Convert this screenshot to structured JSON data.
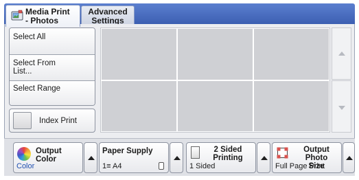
{
  "tabs": [
    {
      "line1": "Media Print",
      "line2": "- Photos",
      "active": true,
      "icon": "media-print-photo-icon"
    },
    {
      "line1": "Advanced",
      "line2": "Settings",
      "active": false
    }
  ],
  "selection": {
    "select_all": "Select All",
    "select_from_list_1": "Select From",
    "select_from_list_2": "List...",
    "select_range": "Select Range"
  },
  "index_print": "Index Print",
  "thumbnails": 6,
  "settings": {
    "output_color": {
      "title": "Output Color",
      "value": "Color",
      "icon": "color-wheel-icon"
    },
    "paper_supply": {
      "title": "Paper Supply",
      "value": "1≡ A4",
      "icon": "paper-tray-icon"
    },
    "two_sided": {
      "title_1": "2 Sided",
      "title_2": "Printing",
      "value": "1 Sided",
      "icon": "two-sided-icon"
    },
    "output_photo_size": {
      "title_1": "Output Photo",
      "title_2": "Size",
      "value": "Full Page Print",
      "icon": "photo-size-icon"
    }
  },
  "colors": {
    "tabbar": "#3c5fb2",
    "panel": "#ecedf0",
    "thumbnail": "#cfd0d4",
    "value_blue": "#1f4fb0"
  }
}
